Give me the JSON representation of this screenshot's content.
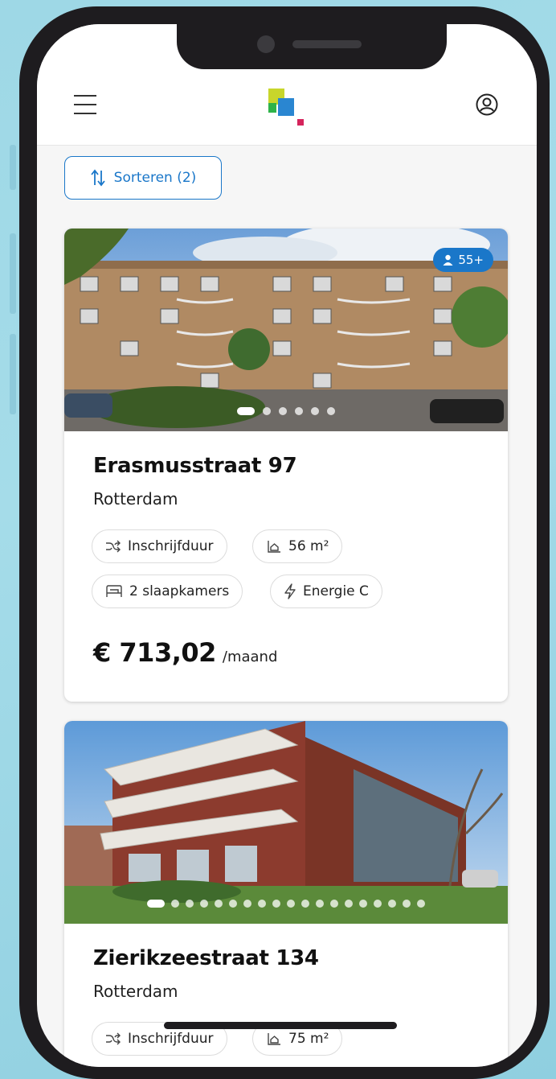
{
  "header": {
    "menu_icon": "hamburger-menu-icon",
    "logo_icon": "brand-logo-icon",
    "profile_icon": "user-circle-icon"
  },
  "sort": {
    "label": "Sorteren (2)",
    "icon": "sort-arrows-icon"
  },
  "listings": [
    {
      "badge": "55+",
      "badge_icon": "person-icon",
      "photo_index": 1,
      "photo_count": 6,
      "title": "Erasmusstraat 97",
      "city": "Rotterdam",
      "chips": [
        {
          "icon": "shuffle-icon",
          "label": "Inschrijfduur"
        },
        {
          "icon": "area-icon",
          "label": "56 m²"
        },
        {
          "icon": "bed-icon",
          "label": "2 slaapkamers"
        },
        {
          "icon": "lightning-icon",
          "label": "Energie C"
        }
      ],
      "price": "€ 713,02",
      "price_unit": "/maand"
    },
    {
      "photo_index": 1,
      "photo_count": 19,
      "title": "Zierikzeestraat 134",
      "city": "Rotterdam",
      "chips": [
        {
          "icon": "shuffle-icon",
          "label": "Inschrijfduur"
        },
        {
          "icon": "area-icon",
          "label": "75 m²"
        }
      ]
    }
  ],
  "colors": {
    "accent": "#1a77c9",
    "background": "#a5dce9",
    "frame": "#1e1c1f"
  }
}
